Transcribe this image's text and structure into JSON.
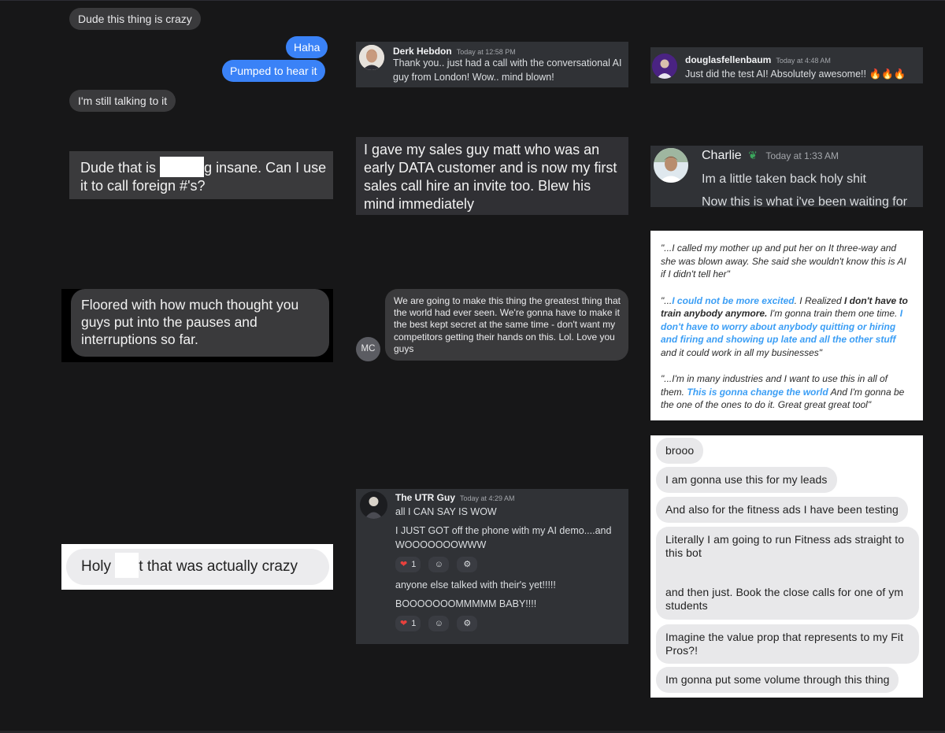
{
  "col1": {
    "msg1": "Dude this thing is crazy",
    "msg2": "Haha",
    "msg3": "Pumped to hear it",
    "msg4": "I'm still talking to it",
    "card1_before": "Dude that is ",
    "card1_after": "g insane. Can I use",
    "card1_line2": "it to call foreign #'s?",
    "card2": "Floored with how much thought you guys put into the pauses and interruptions so far.",
    "card3_before": "Holy ",
    "card3_after": "t that was actually crazy"
  },
  "col2": {
    "derk": {
      "name": "Derk Hebdon",
      "time": "Today at 12:58 PM",
      "text": "Thank you.. just had a call with the conversational AI guy from London! Wow.. mind blown!"
    },
    "sales_card": "I gave my sales guy matt who was an early DATA customer and is now my first sales call hire an invite too. Blew his mind immediately",
    "mc": {
      "initials": "MC",
      "text": "We are going to make this thing the greatest thing that the world had ever seen. We're gonna have to make it the best kept secret at the same time - don't want my competitors getting their hands on this. Lol. Love you guys"
    },
    "utr": {
      "name": "The UTR Guy",
      "time": "Today at 4:29 AM",
      "line1": "all I CAN SAY IS WOW",
      "line2": "I JUST GOT off the phone with my AI demo....and WOOOOOOOWWW",
      "react_count_1": "1",
      "line3": "anyone else talked with their's yet!!!!!",
      "line4": "BOOOOOOOMMMMM BABY!!!!",
      "react_count_2": "1"
    }
  },
  "col3": {
    "douglas": {
      "name": "douglasfellenbaum",
      "time": "Today at 4:48 AM",
      "text": "Just did the test AI! Absolutely awesome!! 🔥🔥🔥"
    },
    "charlie": {
      "name": "Charlie",
      "time": "Today at 1:33 AM",
      "line1": "Im a little taken back holy shit",
      "line2": "Now this is what i've been waiting for"
    },
    "quotes": {
      "q1": "\"...I called my mother up and put her on It three-way and she was blown away. She said she wouldn't know this is AI if I didn't tell her\"",
      "q2_a": "\"...",
      "q2_b": "I could not be more excited",
      "q2_c": ". I Realized ",
      "q2_d": "I don't have to train anybody anymore.",
      "q2_e": " I'm gonna train them one time. ",
      "q2_f": "I don't have to worry about anybody quitting or hiring and firing and showing up late and all the other stuff",
      "q2_g": " and it could work in all my businesses\"",
      "q3_a": "\"...I'm in many industries and I want to use this in all of them. ",
      "q3_b": "This is gonna change the world",
      "q3_c": " And I'm gonna be the one of the ones to do it. Great great great tool\""
    },
    "light": {
      "m1": "brooo",
      "m2": "I am gonna use this for my leads",
      "m3": "And also for the fitness ads I have been testing",
      "m4a": "Literally I am going to run Fitness ads straight to this bot",
      "m4b": "and then just. Book the close calls for one of ym students",
      "m5": "Imagine the value prop that represents to my Fit Pros?!",
      "m6": "Im gonna put some volume through this thing"
    }
  },
  "colors": {
    "background": "#171718",
    "imessage_blue": "#3a82f7",
    "imessage_gray": "#3a3a3c",
    "discord_panel": "#303236",
    "highlight_blue": "#3b9ef5"
  }
}
